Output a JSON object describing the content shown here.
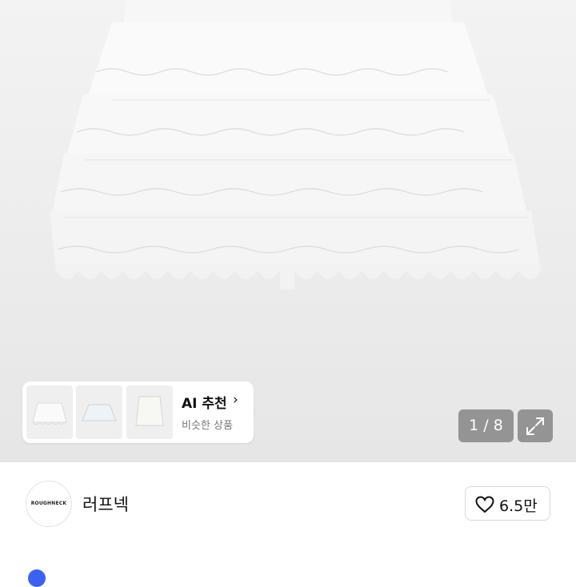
{
  "product_image": {
    "description_icon": "skirt-photo"
  },
  "ai_recommend": {
    "title": "AI 추천",
    "chevron": "›",
    "subtitle": "비슷한 상품"
  },
  "pager": {
    "text": "1 / 8",
    "current": 1,
    "total": 8
  },
  "expand_icon": "expand-icon",
  "brand": {
    "logo_text": "ROUGHNECK",
    "name": "러프넥"
  },
  "like": {
    "count": "6.5만"
  },
  "colors": {
    "accent": "#3a62f0",
    "pager_bg": "#787878"
  }
}
